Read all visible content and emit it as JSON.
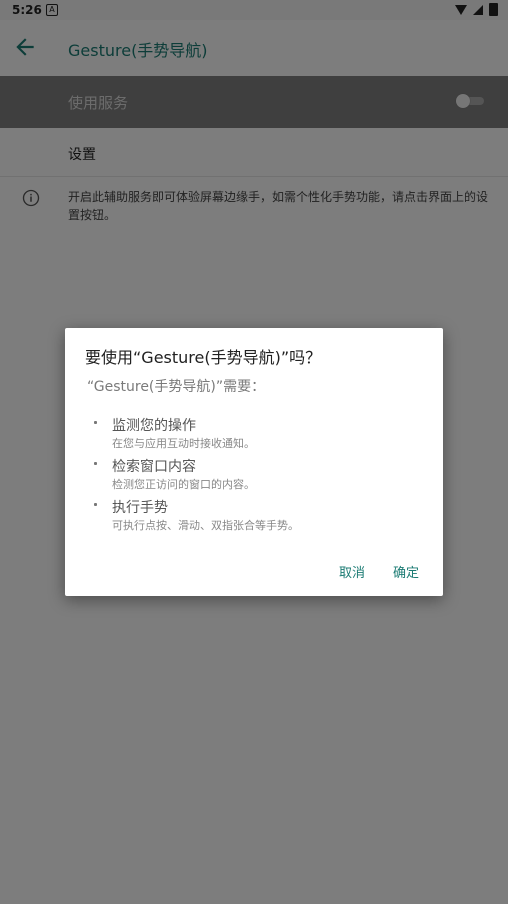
{
  "status_bar": {
    "time": "5:26",
    "notification_letter": "A"
  },
  "app_bar": {
    "title": "Gesture(手势导航)"
  },
  "service": {
    "label": "使用服务",
    "enabled": false
  },
  "settings": {
    "label": "设置"
  },
  "info": {
    "text": "开启此辅助服务即可体验屏幕边缘手，如需个性化手势功能，请点击界面上的设置按钮。"
  },
  "dialog": {
    "title": "要使用“Gesture(手势导航)”吗？",
    "subtitle": "“Gesture(手势导航)”需要：",
    "permissions": [
      {
        "title": "监测您的操作",
        "desc": "在您与应用互动时接收通知。"
      },
      {
        "title": "检索窗口内容",
        "desc": "检测您正访问的窗口的内容。"
      },
      {
        "title": "执行手势",
        "desc": "可执行点按、滑动、双指张合等手势。"
      }
    ],
    "cancel_label": "取消",
    "ok_label": "确定"
  },
  "colors": {
    "accent": "#1b7b73",
    "scrim": "rgba(0,0,0,0.5)"
  }
}
